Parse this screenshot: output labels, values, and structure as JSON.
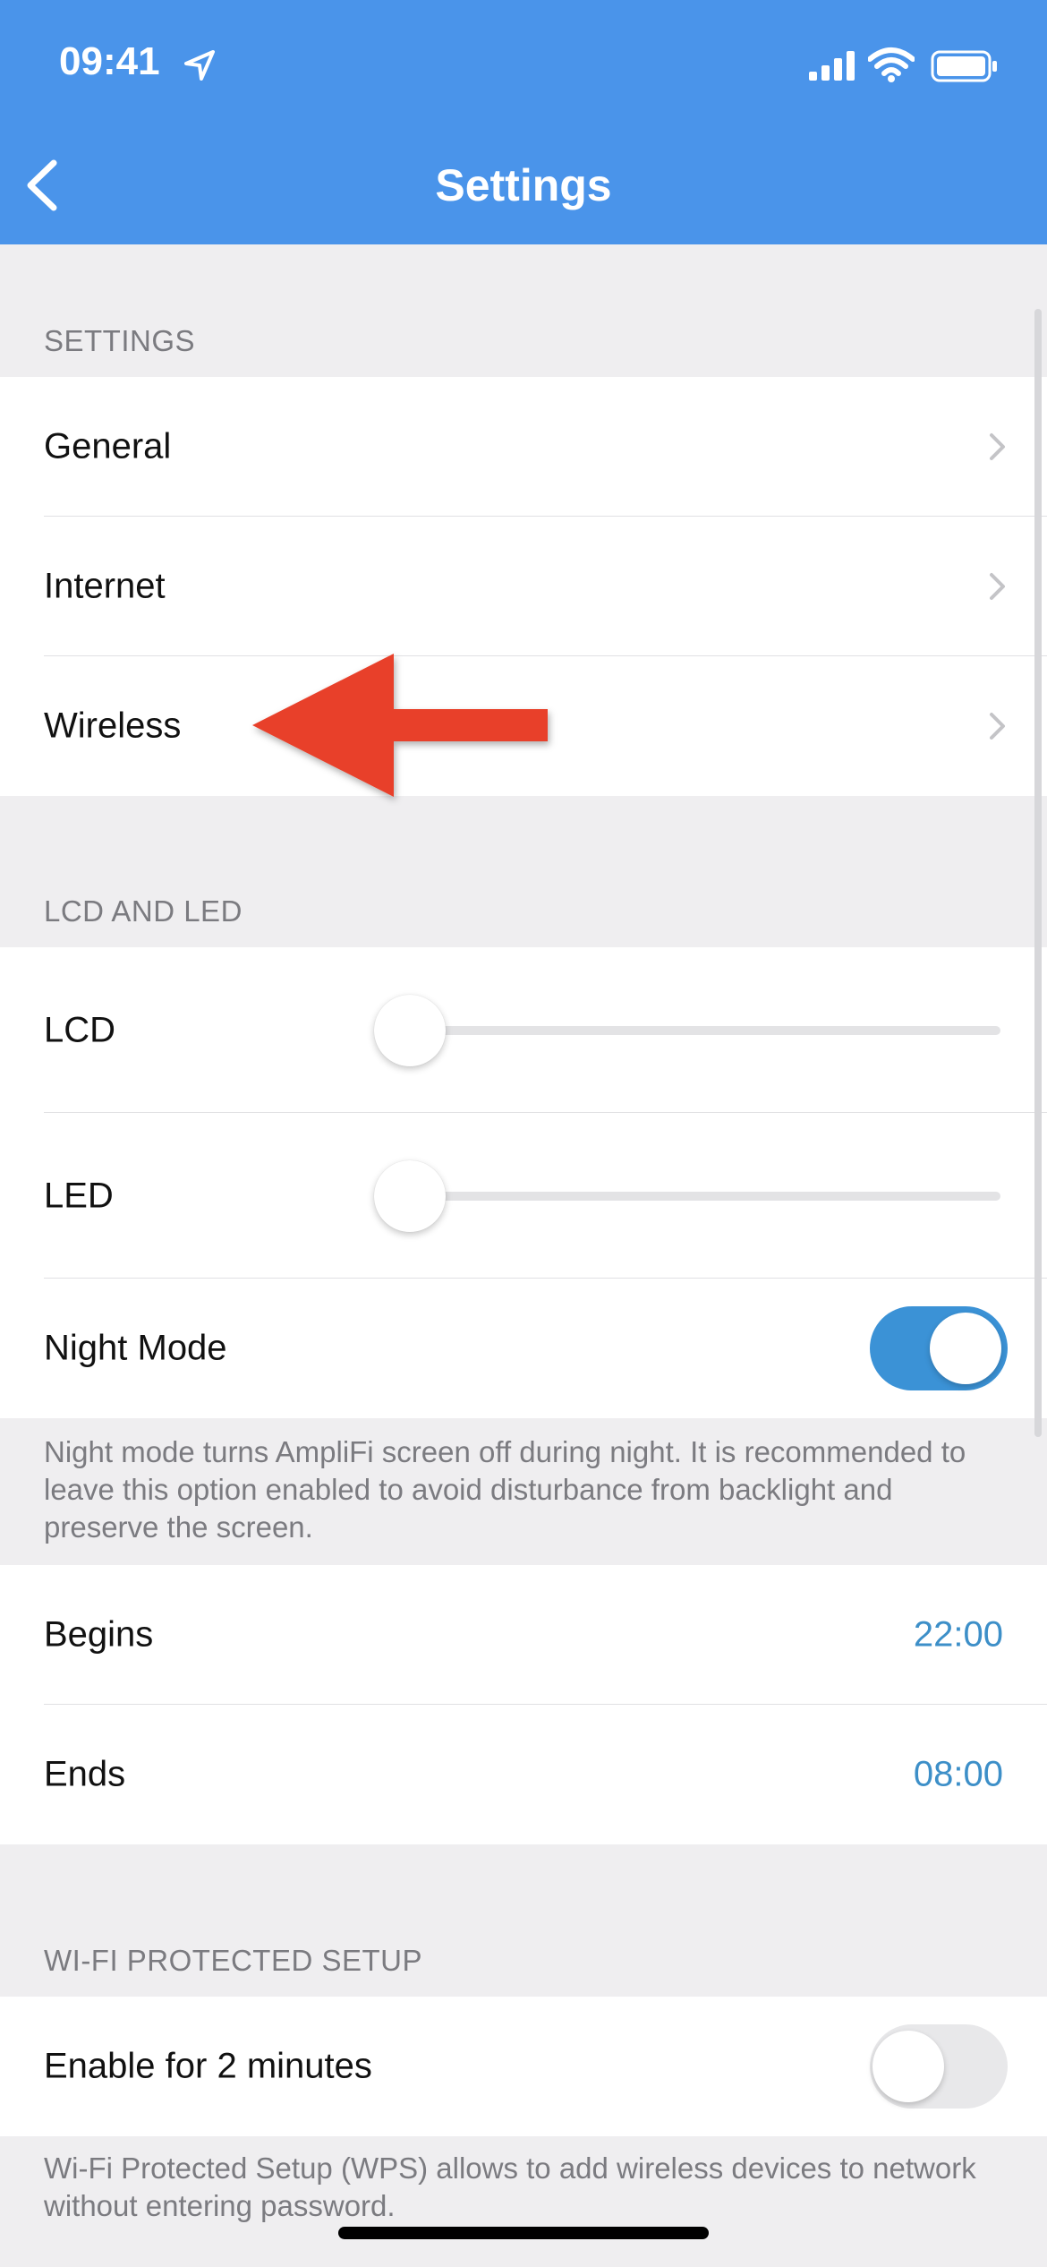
{
  "status_bar": {
    "time": "09:41",
    "icons": [
      "location-arrow-icon",
      "cellular-signal-icon",
      "wifi-icon",
      "battery-icon"
    ]
  },
  "nav": {
    "title": "Settings",
    "back_icon": "chevron-left-icon"
  },
  "sections": {
    "settings": {
      "header": "SETTINGS",
      "items": [
        {
          "label": "General"
        },
        {
          "label": "Internet"
        },
        {
          "label": "Wireless"
        }
      ]
    },
    "lcd_led": {
      "header": "LCD AND LED",
      "lcd_label": "LCD",
      "lcd_level": 0,
      "led_label": "LED",
      "led_level": 0,
      "night_mode_label": "Night Mode",
      "night_mode_on": true,
      "night_mode_note": "Night mode turns AmpliFi screen off during night. It is recommended to leave this option enabled to avoid disturbance from backlight and preserve the screen.",
      "begins_label": "Begins",
      "begins_value": "22:00",
      "ends_label": "Ends",
      "ends_value": "08:00"
    },
    "wps": {
      "header": "WI-FI PROTECTED SETUP",
      "enable_label": "Enable for 2 minutes",
      "enable_on": false,
      "note": "Wi-Fi Protected Setup (WPS) allows to add wireless devices to network without entering password."
    }
  },
  "colors": {
    "nav_bar": "#4a94ea",
    "toggle_on": "#3b92d6",
    "value_text": "#3d8fc8",
    "annotation_arrow": "#e8412c",
    "background": "#efeef0"
  }
}
